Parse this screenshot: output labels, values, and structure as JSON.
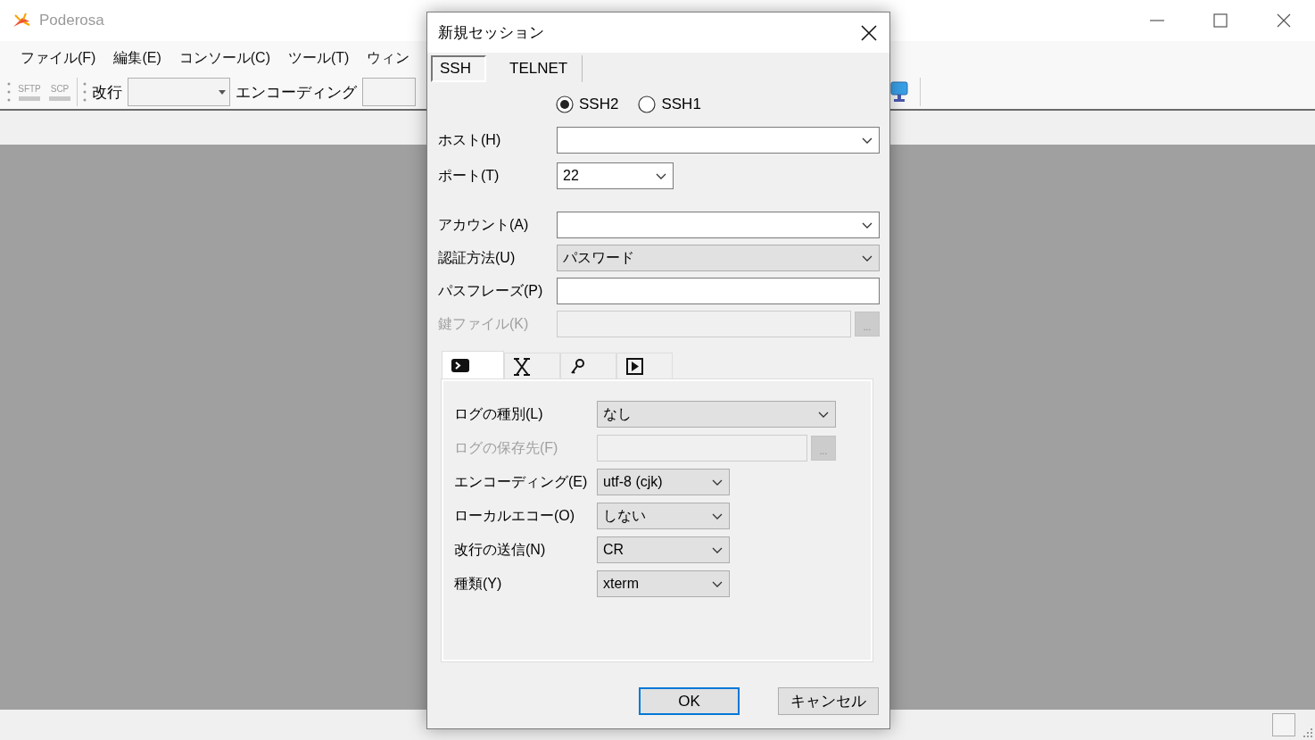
{
  "app": {
    "title": "Poderosa"
  },
  "menu": [
    {
      "label": "ファイル(F)"
    },
    {
      "label": "編集(E)"
    },
    {
      "label": "コンソール(C)"
    },
    {
      "label": "ツール(T)"
    },
    {
      "label": "ウィン"
    }
  ],
  "toolbar": {
    "sftp": {
      "label": "SFTP",
      "disabled": true
    },
    "scp": {
      "label": "SCP",
      "disabled": true
    },
    "newline_label": "改行",
    "encoding_label": "エンコーディング"
  },
  "dialog": {
    "title": "新規セッション",
    "tabs": [
      {
        "label": "SSH",
        "selected": true
      },
      {
        "label": "TELNET",
        "selected": false
      }
    ],
    "protocol_options": [
      {
        "label": "SSH2",
        "selected": true
      },
      {
        "label": "SSH1",
        "selected": false
      }
    ],
    "connection_fields": [
      {
        "label": "ホスト(H)",
        "kind": "combo",
        "wide": true,
        "disabled": false
      },
      {
        "label": "ポート(T)",
        "kind": "combo",
        "value": "22",
        "wide": false,
        "disabled": false
      }
    ],
    "auth_fields": [
      {
        "label": "アカウント(A)",
        "kind": "combo",
        "wide": true,
        "disabled": false
      },
      {
        "label": "認証方法(U)",
        "kind": "dropdown",
        "value": "パスワード",
        "wide": true,
        "disabled": false
      },
      {
        "label": "パスフレーズ(P)",
        "kind": "text",
        "wide": true,
        "disabled": false
      },
      {
        "label": "鍵ファイル(K)",
        "kind": "browse",
        "button": "...",
        "wide": true,
        "disabled": true
      }
    ],
    "sub_tabs": [
      {
        "kind": "terminal",
        "selected": true
      },
      {
        "kind": "x",
        "selected": false
      },
      {
        "kind": "key",
        "selected": false
      },
      {
        "kind": "play",
        "selected": false
      }
    ],
    "log_fields": [
      {
        "label": "ログの種別(L)",
        "kind": "dropdown",
        "value": "なし",
        "wide": true,
        "disabled": false
      },
      {
        "label": "ログの保存先(F)",
        "kind": "browse",
        "button": "...",
        "wide": true,
        "disabled": true
      },
      {
        "label": "エンコーディング(E)",
        "kind": "dropdown",
        "value": "utf-8 (cjk)",
        "wide": false,
        "disabled": false
      },
      {
        "label": "ローカルエコー(O)",
        "kind": "dropdown",
        "value": "しない",
        "wide": false,
        "disabled": false
      },
      {
        "label": "改行の送信(N)",
        "kind": "dropdown",
        "value": "CR",
        "wide": false,
        "disabled": false
      },
      {
        "label": "種類(Y)",
        "kind": "dropdown",
        "value": "xterm",
        "wide": false,
        "disabled": false
      }
    ],
    "buttons": [
      {
        "label": "OK",
        "default": true
      },
      {
        "label": "キャンセル",
        "default": false
      }
    ]
  }
}
